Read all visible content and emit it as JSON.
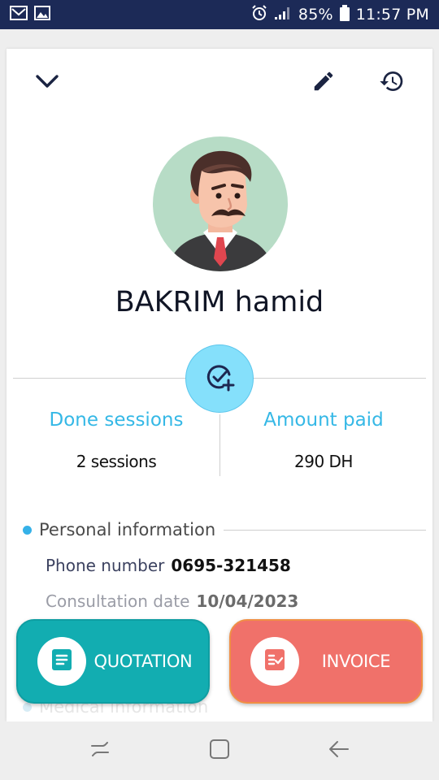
{
  "status_bar": {
    "battery": "85%",
    "time": "11:57 PM",
    "icons": [
      "gmail-icon",
      "gallery-icon",
      "alarm-icon",
      "signal-icon",
      "battery-icon"
    ]
  },
  "toolbar": {
    "icons": [
      "chevron-down-icon",
      "edit-pencil-icon",
      "history-icon"
    ]
  },
  "patient": {
    "name": "BAKRIM hamid",
    "avatar_icon": "man-avatar-illustration"
  },
  "stats": {
    "done_sessions": {
      "label": "Done sessions",
      "value": "2 sessions"
    },
    "amount_paid": {
      "label": "Amount paid",
      "value": "290 DH"
    }
  },
  "sections": {
    "personal": {
      "title": "Personal information",
      "fields": [
        {
          "label": "Phone number",
          "value": "0695-321458"
        },
        {
          "label": "Consultation date",
          "value": "10/04/2023"
        }
      ]
    },
    "medical": {
      "title": "Medical information"
    }
  },
  "actions": {
    "quotation": {
      "label": "QUOTATION",
      "icon": "document-icon"
    },
    "invoice": {
      "label": "INVOICE",
      "icon": "invoice-check-icon"
    }
  },
  "nav_bar": {
    "icons": [
      "recent-apps-icon",
      "home-icon",
      "back-icon"
    ]
  },
  "colors": {
    "status_bar": "#1c2a57",
    "accent_blue": "#35b8e6",
    "quotation": "#12adb1",
    "invoice": "#f0716a",
    "avatar_bg": "#b7dcc6"
  }
}
